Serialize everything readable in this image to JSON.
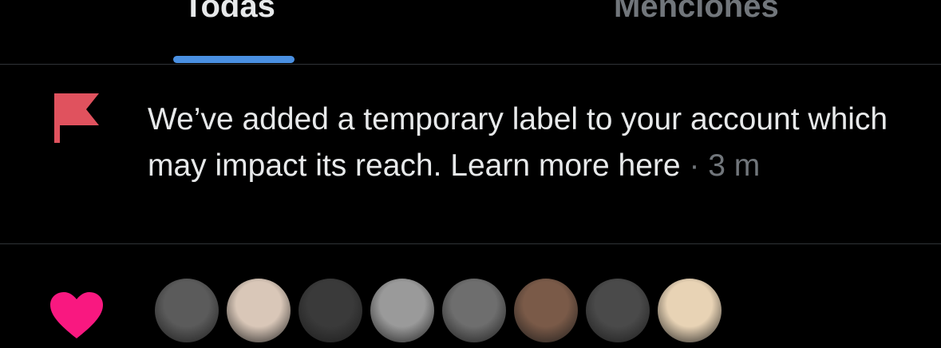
{
  "tabs": [
    {
      "label": "Todas",
      "active": true
    },
    {
      "label": "Menciones",
      "active": false
    }
  ],
  "colors": {
    "background": "#000000",
    "primary_text": "#e7e9ea",
    "secondary_text": "#71767b",
    "accent": "#4a90e2",
    "flag": "#e0525e",
    "heart": "#f91880",
    "divider": "#2f3336"
  },
  "notification": {
    "icon": "flag-icon",
    "message": "We’ve added a temporary label to your account which may impact its reach. Learn more here",
    "separator": " · ",
    "time": "3 m"
  },
  "likes_notification": {
    "icon": "heart-icon",
    "avatars": [
      {
        "name": "avatar-1",
        "tone": "#5b5b5b"
      },
      {
        "name": "avatar-2",
        "tone": "#d9c7b8"
      },
      {
        "name": "avatar-3",
        "tone": "#3a3a3a"
      },
      {
        "name": "avatar-4",
        "tone": "#9a9a9a"
      },
      {
        "name": "avatar-5",
        "tone": "#6e6e6e"
      },
      {
        "name": "avatar-6",
        "tone": "#7a5a48"
      },
      {
        "name": "avatar-7",
        "tone": "#4a4a4a"
      },
      {
        "name": "avatar-8",
        "tone": "#e8d3b5"
      }
    ]
  }
}
